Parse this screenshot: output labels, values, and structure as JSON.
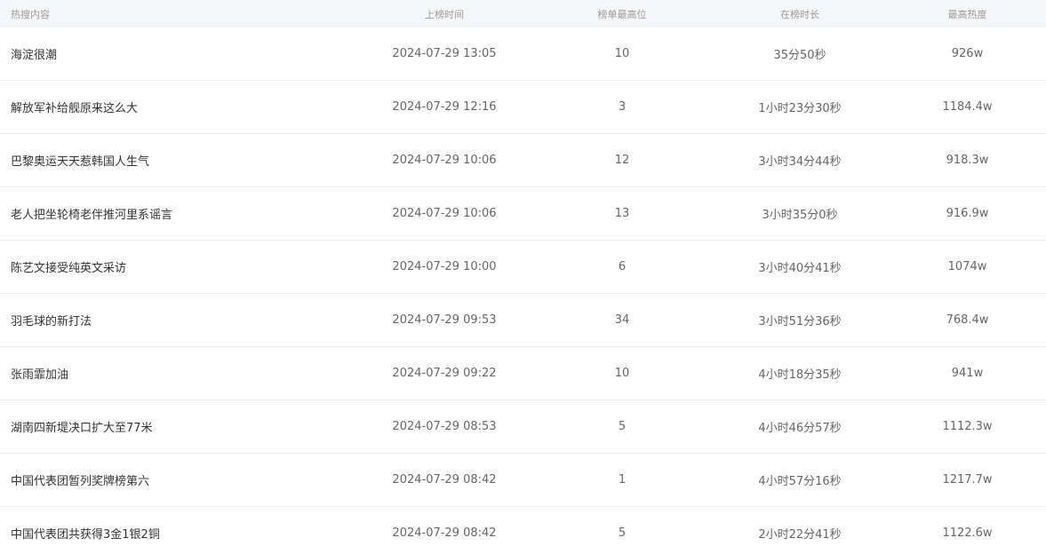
{
  "header": {
    "content": "热搜内容",
    "time": "上榜时间",
    "highest_rank": "榜单最高位",
    "duration": "在榜时长",
    "highest_heat": "最高热度"
  },
  "rows": [
    {
      "content": "海淀很潮",
      "time": "2024-07-29 13:05",
      "rank": "10",
      "duration": "35分50秒",
      "heat": "926w"
    },
    {
      "content": "解放军补给舰原来这么大",
      "time": "2024-07-29 12:16",
      "rank": "3",
      "duration": "1小时23分30秒",
      "heat": "1184.4w"
    },
    {
      "content": "巴黎奥运天天惹韩国人生气",
      "time": "2024-07-29 10:06",
      "rank": "12",
      "duration": "3小时34分44秒",
      "heat": "918.3w"
    },
    {
      "content": "老人把坐轮椅老伴推河里系谣言",
      "time": "2024-07-29 10:06",
      "rank": "13",
      "duration": "3小时35分0秒",
      "heat": "916.9w"
    },
    {
      "content": "陈艺文接受纯英文采访",
      "time": "2024-07-29 10:00",
      "rank": "6",
      "duration": "3小时40分41秒",
      "heat": "1074w"
    },
    {
      "content": "羽毛球的新打法",
      "time": "2024-07-29 09:53",
      "rank": "34",
      "duration": "3小时51分36秒",
      "heat": "768.4w"
    },
    {
      "content": "张雨霏加油",
      "time": "2024-07-29 09:22",
      "rank": "10",
      "duration": "4小时18分35秒",
      "heat": "941w"
    },
    {
      "content": "湖南四新堤决口扩大至77米",
      "time": "2024-07-29 08:53",
      "rank": "5",
      "duration": "4小时46分57秒",
      "heat": "1112.3w"
    },
    {
      "content": "中国代表团暂列奖牌榜第六",
      "time": "2024-07-29 08:42",
      "rank": "1",
      "duration": "4小时57分16秒",
      "heat": "1217.7w"
    },
    {
      "content": "中国代表团共获得3金1银2铜",
      "time": "2024-07-29 08:42",
      "rank": "5",
      "duration": "2小时22分41秒",
      "heat": "1122.6w"
    }
  ]
}
